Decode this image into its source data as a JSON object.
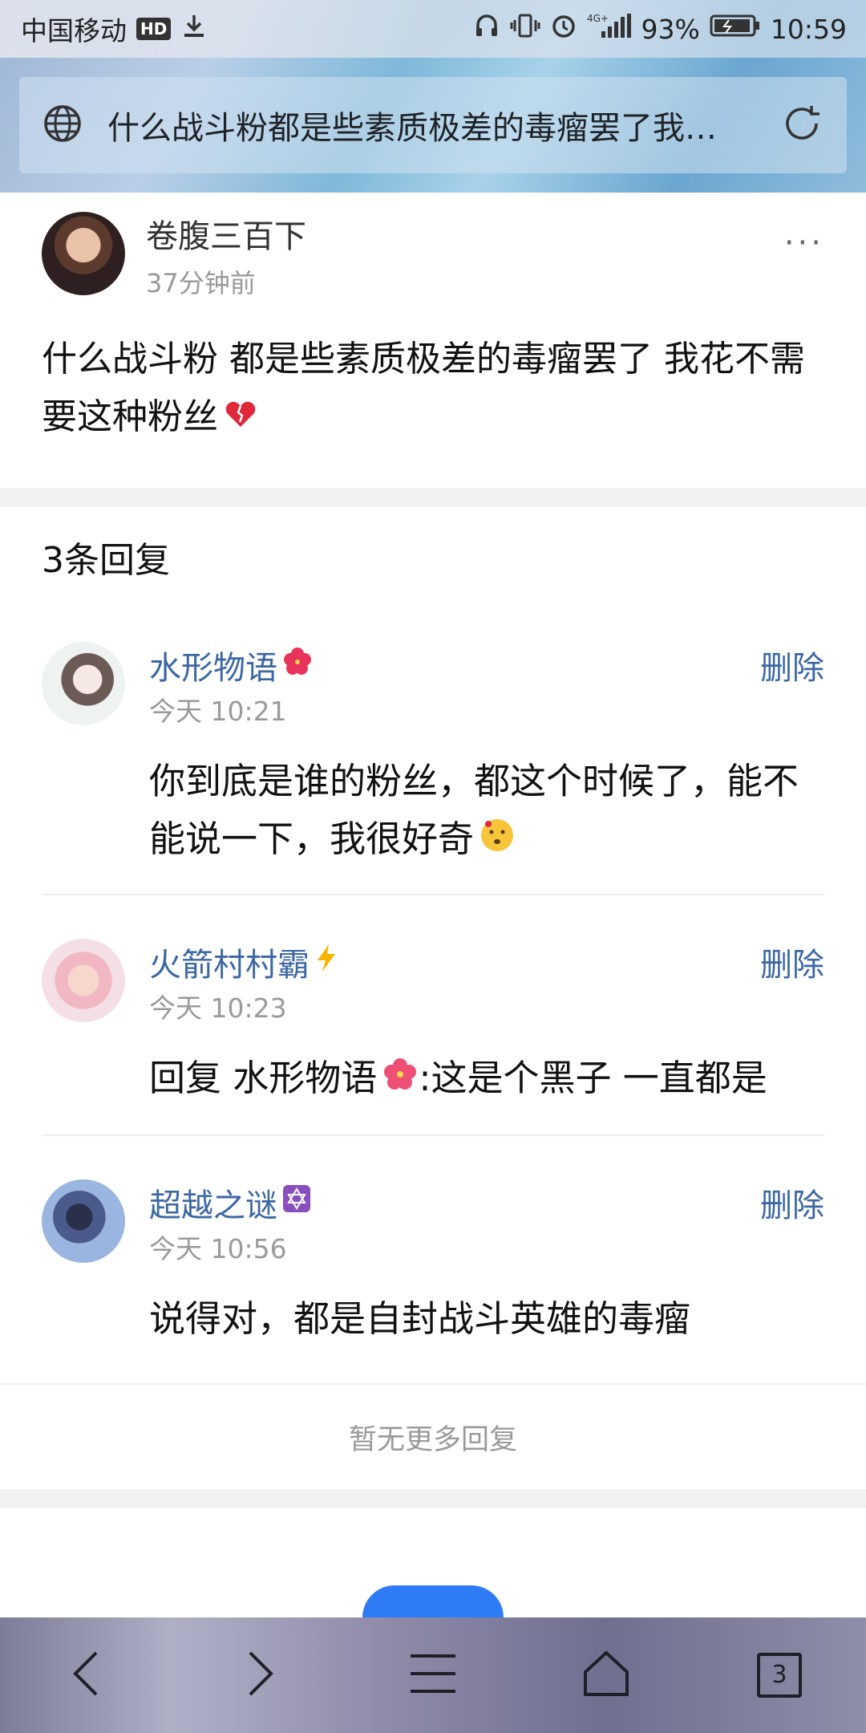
{
  "status_bar": {
    "carrier": "中国移动",
    "hd_badge": "HD",
    "battery_percent": "93%",
    "network": "4G+",
    "time": "10:59",
    "icons": [
      "download-icon",
      "headphone-icon",
      "vibrate-icon",
      "alarm-icon",
      "signal-icon",
      "battery-icon"
    ]
  },
  "address_bar": {
    "title": "什么战斗粉都是些素质极差的毒瘤罢了我…",
    "icons": [
      "globe-icon",
      "refresh-icon"
    ]
  },
  "post": {
    "author": "卷腹三百下",
    "time": "37分钟前",
    "content": "什么战斗粉 都是些素质极差的毒瘤罢了 我花不需要这种粉丝",
    "content_emoji": "broken-heart-icon",
    "more_label": "···"
  },
  "replies": {
    "count_label": "3条回复",
    "delete_label": "删除",
    "items": [
      {
        "name": "水形物语",
        "name_emoji": "hibiscus-icon",
        "date": "今天 10:21",
        "text": "你到底是谁的粉丝，都这个时候了，能不能说一下，我很好奇",
        "text_emoji": "thinking-face-icon"
      },
      {
        "name": "火箭村村霸",
        "name_emoji": "lightning-icon",
        "date": "今天 10:23",
        "text_prefix": "回复 水形物语",
        "text_emoji": "hibiscus-icon",
        "text_suffix": ":这是个黑子 一直都是"
      },
      {
        "name": "超越之谜",
        "name_emoji": "star-of-david-icon",
        "date": "今天 10:56",
        "text": "说得对，都是自封战斗英雄的毒瘤"
      }
    ],
    "no_more": "暂无更多回复"
  },
  "bottom_nav": {
    "tab_count": "3",
    "icons": [
      "back-arrow-icon",
      "forward-arrow-icon",
      "menu-icon",
      "home-icon",
      "tabs-icon"
    ]
  }
}
